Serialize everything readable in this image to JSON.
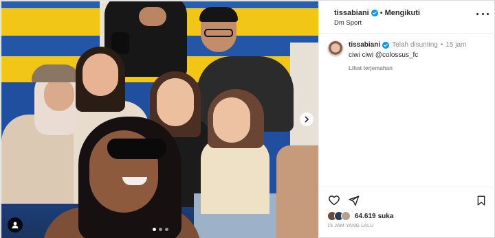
{
  "post": {
    "username": "tissabiani",
    "follow_status": "Mengikuti",
    "location": "Dm Sport",
    "caption": {
      "username": "tissabiani",
      "edited": "Telah disunting",
      "time": "15 jam",
      "text": "ciwi ciwi @colossus_fc",
      "translate": "Lihat terjemahan"
    },
    "likes_count": "64.619",
    "likes_word": "suka",
    "time_ago": "15 JAM YANG LALU",
    "carousel": {
      "total": 3,
      "current": 1
    }
  },
  "icons": {
    "verified": "verified-badge-icon",
    "more": "more-options-icon",
    "next": "chevron-right-icon",
    "tag": "user-tag-icon",
    "like": "heart-icon",
    "share": "send-icon",
    "save": "bookmark-icon"
  },
  "colors": {
    "verified": "#0095f6",
    "text_primary": "#262626",
    "text_secondary": "#8e8e8e"
  }
}
